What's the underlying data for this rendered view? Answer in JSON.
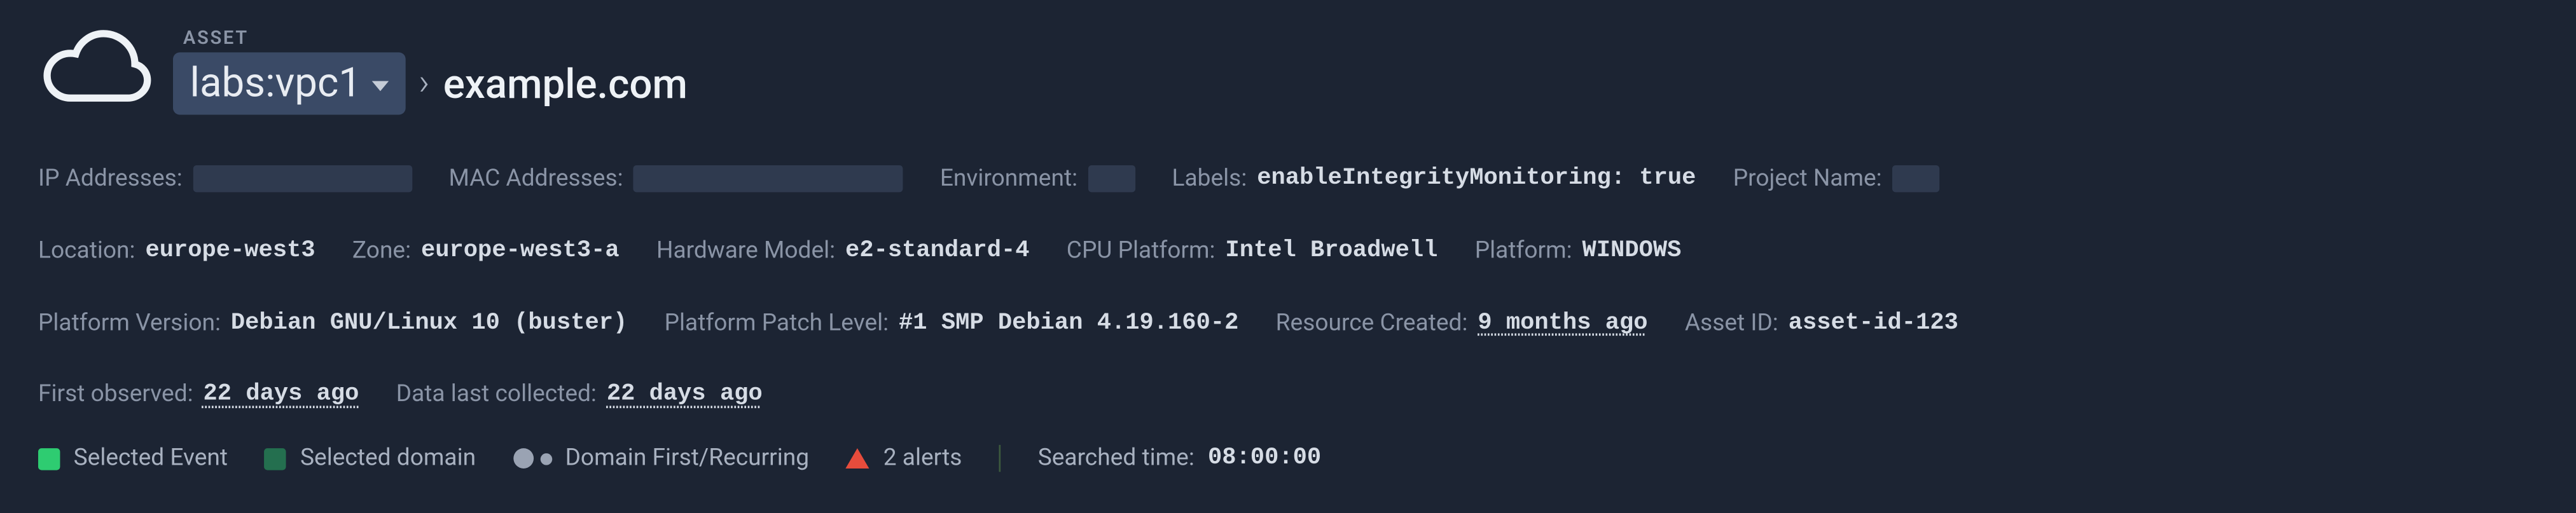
{
  "header": {
    "asset_label": "ASSET",
    "chip": "labs:vpc1",
    "domain": "example.com"
  },
  "meta": {
    "ip_addresses_label": "IP Addresses:",
    "mac_addresses_label": "MAC Addresses:",
    "environment_label": "Environment:",
    "labels_label": "Labels:",
    "labels_value": "enableIntegrityMonitoring: true",
    "project_name_label": "Project Name:",
    "location_label": "Location:",
    "location_value": "europe-west3",
    "zone_label": "Zone:",
    "zone_value": "europe-west3-a",
    "hardware_model_label": "Hardware Model:",
    "hardware_model_value": "e2-standard-4",
    "cpu_platform_label": "CPU Platform:",
    "cpu_platform_value": "Intel Broadwell",
    "platform_label": "Platform:",
    "platform_value": "WINDOWS",
    "platform_version_label": "Platform Version:",
    "platform_version_value": "Debian GNU/Linux 10 (buster)",
    "platform_patch_label": "Platform Patch Level:",
    "platform_patch_value": "#1 SMP Debian 4.19.160-2",
    "resource_created_label": "Resource Created:",
    "resource_created_value": "9 months ago",
    "asset_id_label": "Asset ID:",
    "asset_id_value": "asset-id-123",
    "first_observed_label": "First observed:",
    "first_observed_value": "22 days ago",
    "data_last_collected_label": "Data last collected:",
    "data_last_collected_value": "22 days ago"
  },
  "legend": {
    "selected_event": "Selected Event",
    "selected_domain": "Selected domain",
    "domain_first_recurring": "Domain First/Recurring",
    "alerts": "2 alerts",
    "searched_time_label": "Searched time:",
    "searched_time_value": "08:00:00"
  }
}
